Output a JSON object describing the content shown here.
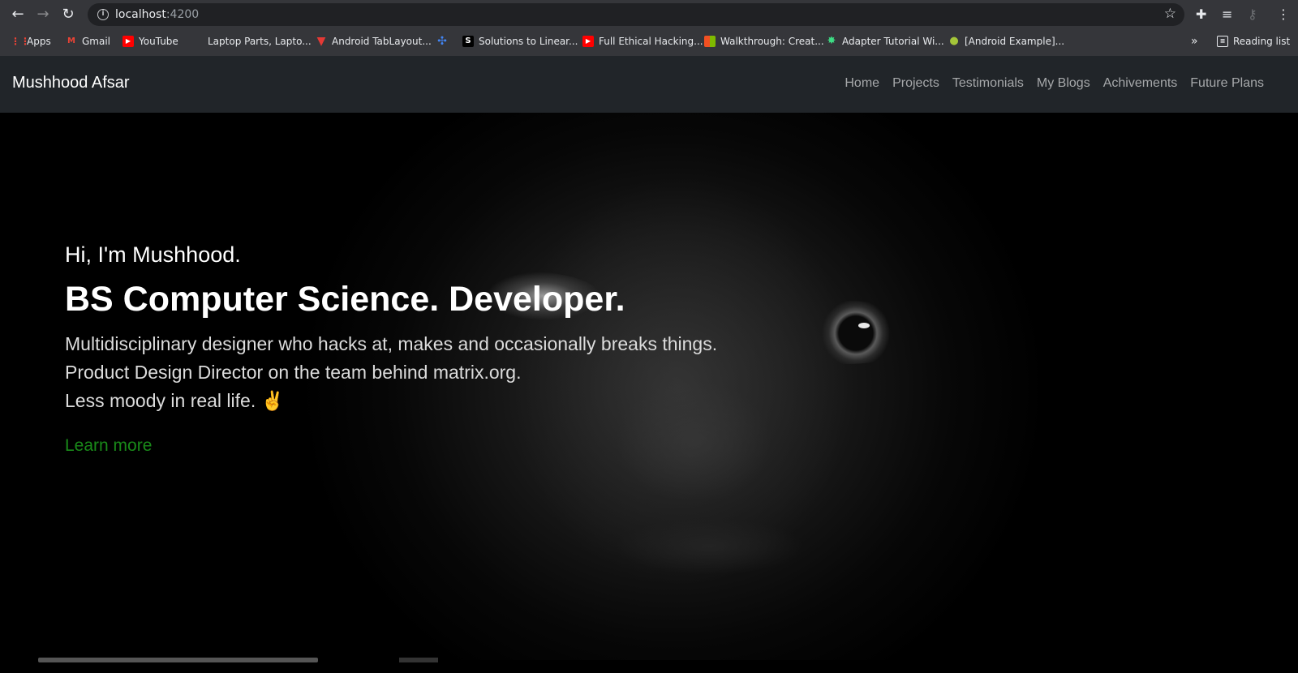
{
  "browser": {
    "url_host": "localhost",
    "url_port": ":4200",
    "bookmarks": [
      {
        "label": "Apps",
        "icon": "apps-grid-icon",
        "color": "#ea4335"
      },
      {
        "label": "Gmail",
        "icon": "gmail-icon",
        "color": "#ea4335"
      },
      {
        "label": "YouTube",
        "icon": "youtube-icon",
        "color": "#ff0000"
      },
      {
        "label": "Laptop Parts, Lapto...",
        "icon": "blank-icon",
        "color": "#35363a"
      },
      {
        "label": "Android TabLayout...",
        "icon": "triangle-icon",
        "color": "#e53935"
      },
      {
        "label": "",
        "icon": "pinwheel-icon",
        "color": "#4285f4"
      },
      {
        "label": "Solutions to Linear...",
        "icon": "s-icon",
        "color": "#000000"
      },
      {
        "label": "Full Ethical Hacking...",
        "icon": "youtube-icon",
        "color": "#ff0000"
      },
      {
        "label": "Walkthrough: Creat...",
        "icon": "microsoft-icon",
        "color": "#f25022"
      },
      {
        "label": "Adapter Tutorial Wi...",
        "icon": "android-star-icon",
        "color": "#3ddc84"
      },
      {
        "label": "[Android Example]...",
        "icon": "android-icon",
        "color": "#a4c639"
      }
    ],
    "reading_list": "Reading list"
  },
  "navbar": {
    "brand": "Mushhood Afsar",
    "links": [
      "Home",
      "Projects",
      "Testimonials",
      "My Blogs",
      "Achivements",
      "Future Plans"
    ]
  },
  "hero": {
    "greeting": "Hi, I'm Mushhood.",
    "headline": "BS Computer Science. Developer.",
    "lines": [
      "Multidisciplinary designer who hacks at, makes and occasionally breaks things.",
      "Product Design Director on the team behind matrix.org.",
      "Less moody in real life. ✌️"
    ],
    "cta": "Learn more",
    "cta_color": "#198a19"
  }
}
